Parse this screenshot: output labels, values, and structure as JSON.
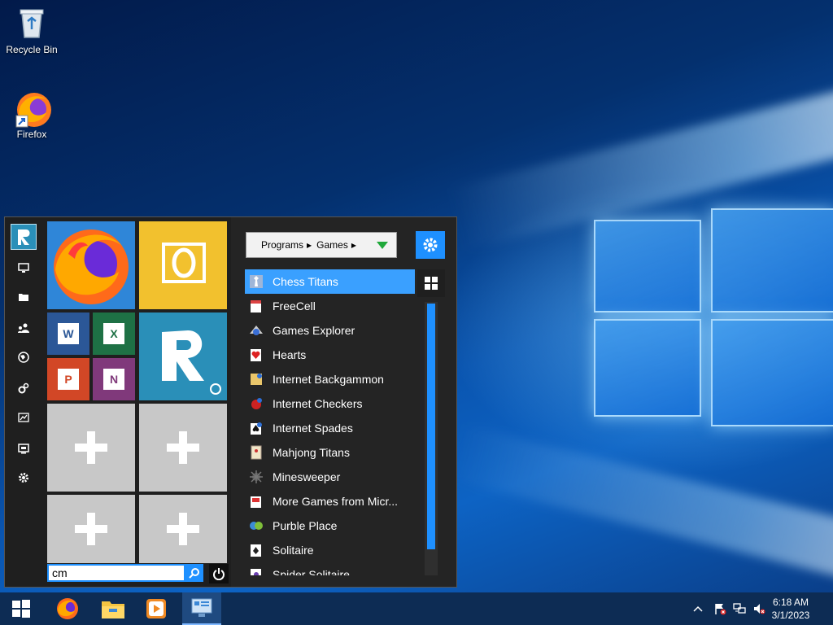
{
  "desktop": {
    "icons": [
      {
        "label": "Recycle Bin"
      },
      {
        "label": "Firefox"
      }
    ]
  },
  "start_menu": {
    "breadcrumb": {
      "items": [
        "Programs",
        "Games"
      ]
    },
    "search": {
      "value": "cm"
    },
    "games": [
      {
        "label": "Chess Titans",
        "selected": true
      },
      {
        "label": "FreeCell"
      },
      {
        "label": "Games Explorer"
      },
      {
        "label": "Hearts"
      },
      {
        "label": "Internet Backgammon"
      },
      {
        "label": "Internet Checkers"
      },
      {
        "label": "Internet Spades"
      },
      {
        "label": "Mahjong Titans"
      },
      {
        "label": "Minesweeper"
      },
      {
        "label": "More Games from Micr..."
      },
      {
        "label": "Purble Place"
      },
      {
        "label": "Solitaire"
      },
      {
        "label": "Spider Solitaire"
      }
    ],
    "tiles": {
      "office_letters": {
        "word": "W",
        "excel": "X",
        "powerpoint": "P",
        "onenote": "N",
        "outlook": "O"
      }
    },
    "colors": {
      "accent": "#1e90ff",
      "selected": "#3aa0ff",
      "outlook": "#f2c12e",
      "word": "#2b5797",
      "excel": "#1e7145",
      "powerpoint": "#d24726",
      "onenote": "#80397b",
      "tile_teal": "#2a8fb8"
    }
  },
  "taskbar": {
    "clock": {
      "time": "6:18 AM",
      "date": "3/1/2023"
    }
  }
}
